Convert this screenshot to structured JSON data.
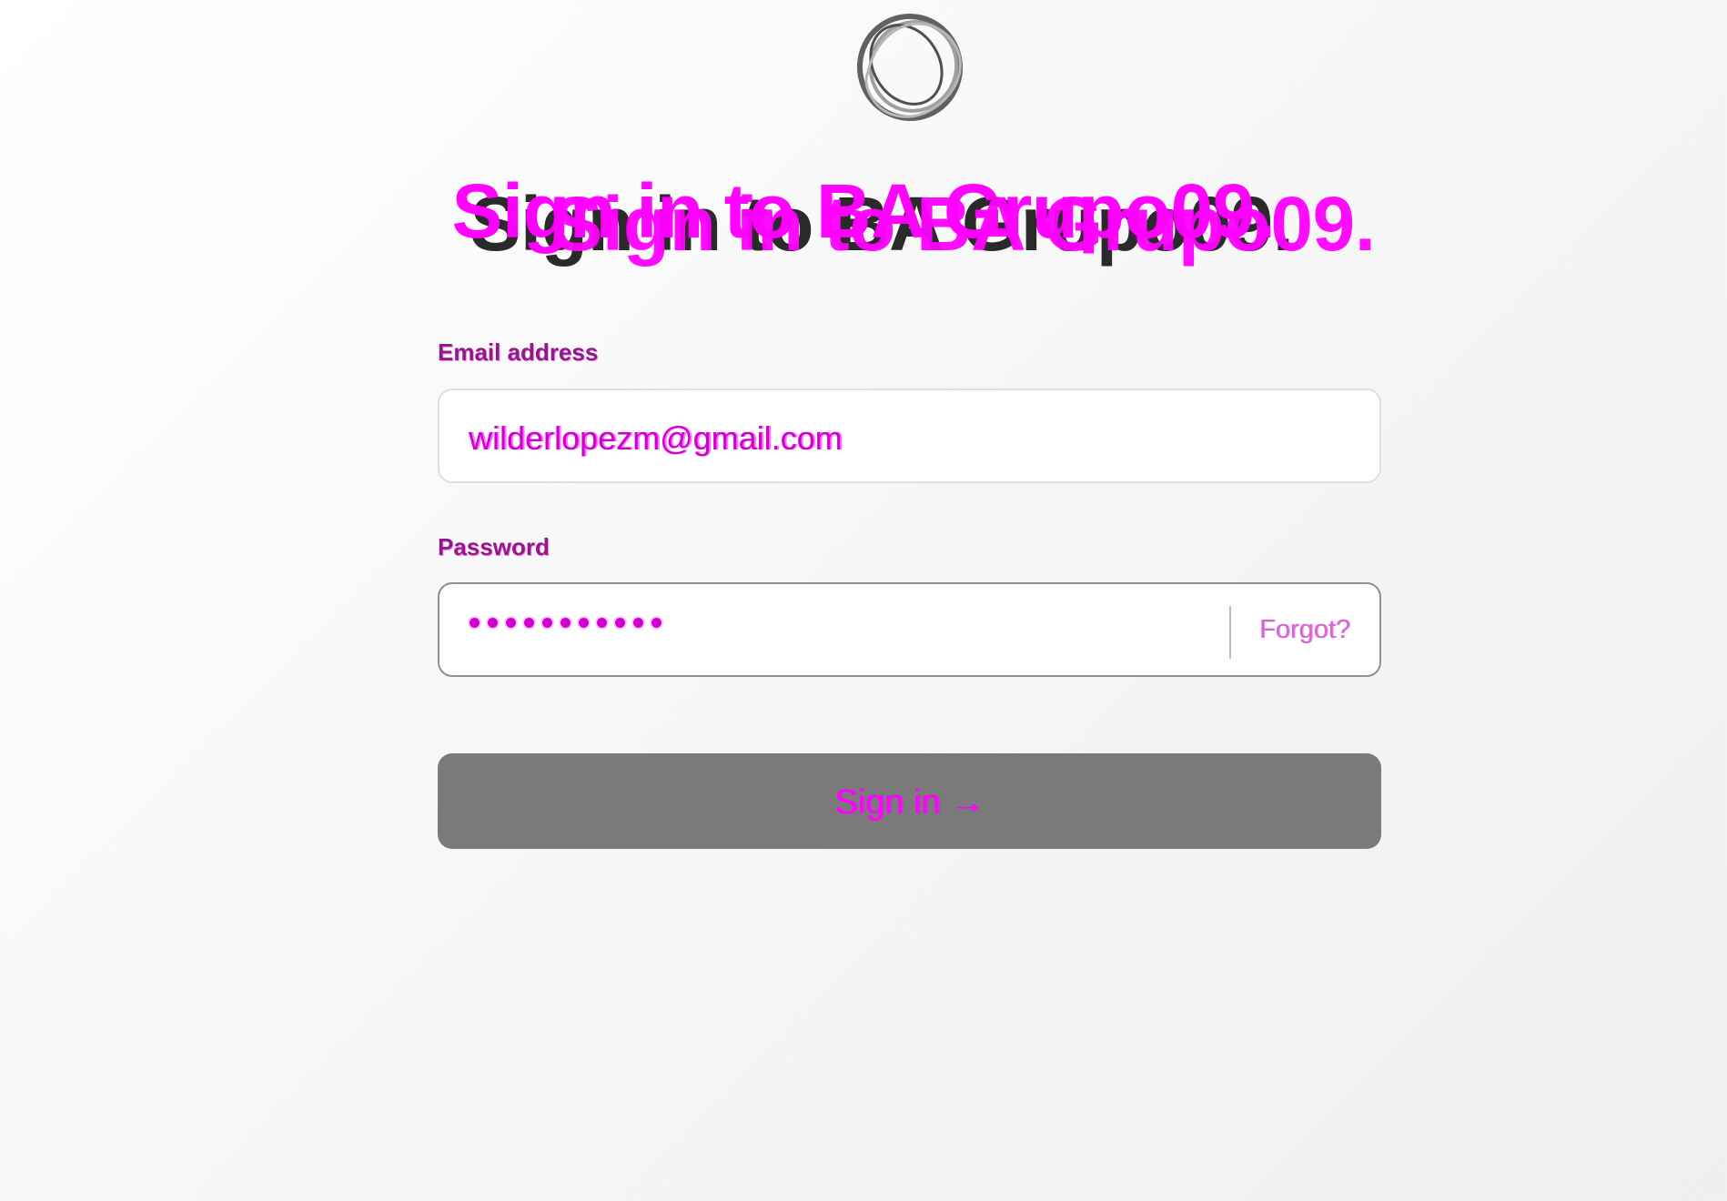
{
  "header": {
    "title": "Sign in to BA Grupo09."
  },
  "form": {
    "email_label": "Email address",
    "email_value": "wilderlopezm@gmail.com",
    "password_label": "Password",
    "forgot_label": "Forgot?",
    "submit_label": "Sign in →"
  },
  "colors": {
    "overlay_accent": "#ff00ff",
    "button_bg": "#7a7a7a"
  },
  "icons": {
    "logo": "ring-logo-icon"
  }
}
